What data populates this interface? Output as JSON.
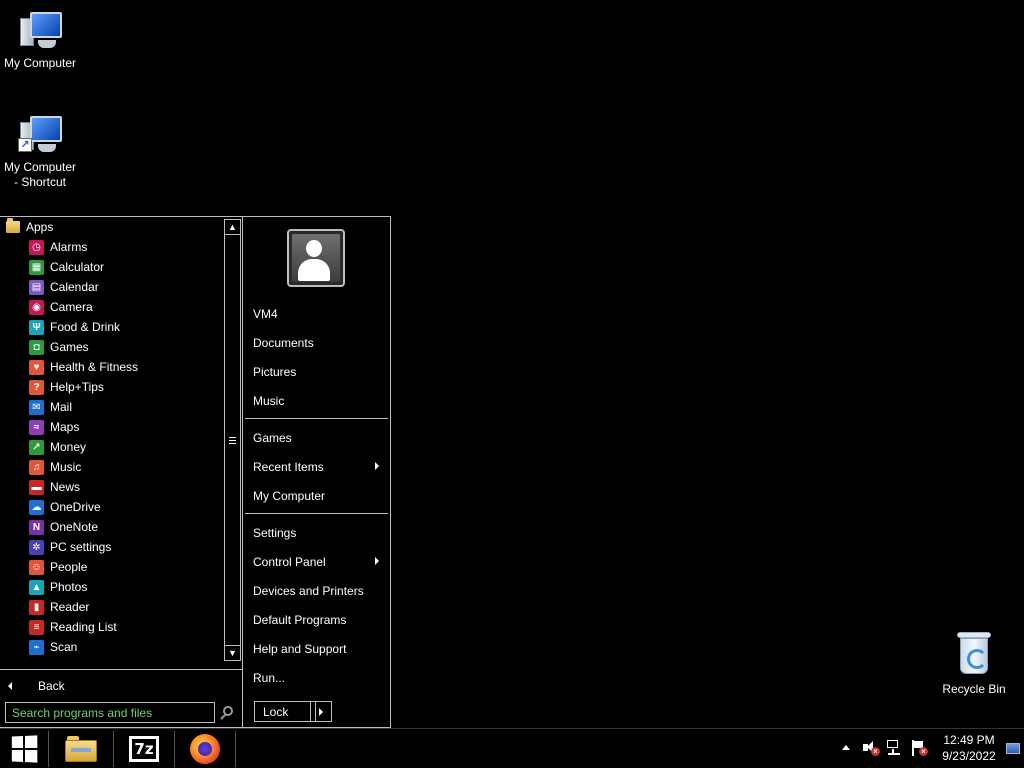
{
  "desktop": {
    "icons": [
      {
        "label": "My Computer"
      },
      {
        "label": "My Computer\n- Shortcut"
      }
    ],
    "recycle_bin": {
      "label": "Recycle Bin"
    }
  },
  "start_menu": {
    "apps_header": "Apps",
    "apps": [
      {
        "label": "Alarms",
        "icon": "alarm-icon",
        "color": "#c2185b"
      },
      {
        "label": "Calculator",
        "icon": "calculator-icon",
        "color": "#2e9a3c"
      },
      {
        "label": "Calendar",
        "icon": "calendar-icon",
        "color": "#7e57c2"
      },
      {
        "label": "Camera",
        "icon": "camera-icon",
        "color": "#c2185b"
      },
      {
        "label": "Food & Drink",
        "icon": "food-drink-icon",
        "color": "#1aa5b8"
      },
      {
        "label": "Games",
        "icon": "games-icon",
        "color": "#2e9a3c"
      },
      {
        "label": "Health & Fitness",
        "icon": "health-icon",
        "color": "#e2553a"
      },
      {
        "label": "Help+Tips",
        "icon": "help-icon",
        "color": "#e2553a"
      },
      {
        "label": "Mail",
        "icon": "mail-icon",
        "color": "#1e6fd0"
      },
      {
        "label": "Maps",
        "icon": "maps-icon",
        "color": "#8e3fb5"
      },
      {
        "label": "Money",
        "icon": "money-icon",
        "color": "#2e9a3c"
      },
      {
        "label": "Music",
        "icon": "music-icon",
        "color": "#e2553a"
      },
      {
        "label": "News",
        "icon": "news-icon",
        "color": "#c62828"
      },
      {
        "label": "OneDrive",
        "icon": "onedrive-icon",
        "color": "#1e6fd0"
      },
      {
        "label": "OneNote",
        "icon": "onenote-icon",
        "color": "#7b2fa8"
      },
      {
        "label": "PC settings",
        "icon": "gear-icon",
        "color": "#4b3fb3"
      },
      {
        "label": "People",
        "icon": "people-icon",
        "color": "#e2553a"
      },
      {
        "label": "Photos",
        "icon": "photos-icon",
        "color": "#1aa5b8"
      },
      {
        "label": "Reader",
        "icon": "reader-icon",
        "color": "#c62828"
      },
      {
        "label": "Reading List",
        "icon": "reading-list-icon",
        "color": "#c62828"
      },
      {
        "label": "Scan",
        "icon": "scan-icon",
        "color": "#1e6fd0"
      }
    ],
    "back_label": "Back",
    "search_placeholder": "Search programs and files",
    "right_items": [
      {
        "label": "VM4"
      },
      {
        "label": "Documents"
      },
      {
        "label": "Pictures"
      },
      {
        "label": "Music"
      },
      {
        "label": "Games"
      },
      {
        "label": "Recent Items",
        "submenu": true
      },
      {
        "label": "My Computer"
      },
      {
        "label": "Settings"
      },
      {
        "label": "Control Panel",
        "submenu": true
      },
      {
        "label": "Devices and Printers"
      },
      {
        "label": "Default Programs"
      },
      {
        "label": "Help and Support"
      },
      {
        "label": "Run..."
      }
    ],
    "lock_label": "Lock"
  },
  "taskbar": {
    "time": "12:49 PM",
    "date": "9/23/2022",
    "pinned": [
      "file-explorer-icon",
      "7zip-icon",
      "firefox-icon"
    ],
    "sevenzip_text": "7z"
  },
  "colors": {
    "search_placeholder": "#6bd36b",
    "border": "#bdbdbd"
  }
}
